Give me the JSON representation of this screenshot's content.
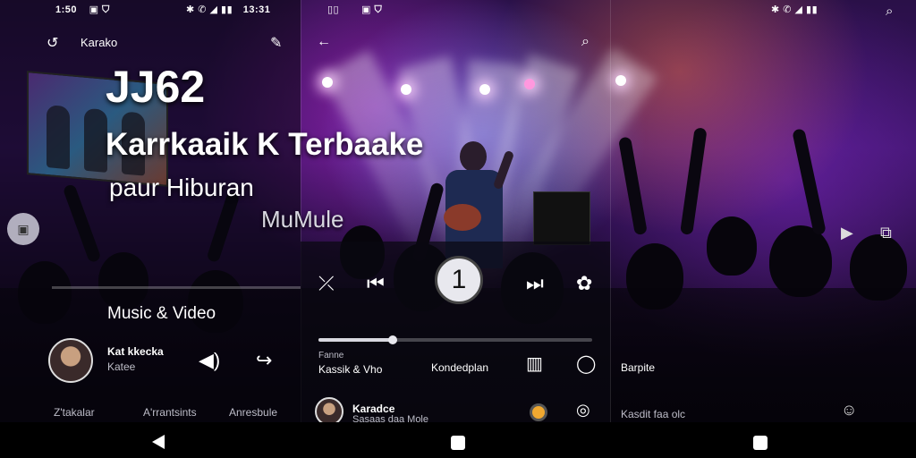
{
  "status_left": {
    "time": "1:50",
    "icons": "▣ ⛉"
  },
  "status_mid": {
    "left_icons": "▯▯",
    "center_icons": "▣ ⛉"
  },
  "status_right": {
    "icons": "✱ ✆ ◢ ▮▮",
    "time": "13:31"
  },
  "status_far_right": {
    "icons": "✱ ✆ ◢ ▮▮"
  },
  "left_panel": {
    "app_title": "Karako",
    "big_title": "JJ62",
    "title_line2": "Karrkaaik K Terbaake",
    "title_line3": "paur Hiburan",
    "mulele": "MuMule",
    "section_title": "Music & Video",
    "user_name": "Kat kkecka",
    "user_sub": "Katee",
    "tabs": [
      "Z'takalar",
      "A'rrantsints",
      "Anresbule"
    ]
  },
  "mid_panel": {
    "play_number": "1",
    "progress": 0.27,
    "meta_label": "Fanne",
    "meta_value": "Kassik  &  Vho",
    "center_label": "Kondedplan",
    "user_name": "Karadce",
    "user_sub": "Sasaas daa Mole"
  },
  "right_panel": {
    "label": "Barpite",
    "bottom_text": "Kasdit  faa  olc"
  },
  "icons": {
    "back": "back-arrow-icon",
    "search": "search-icon",
    "edit": "edit-icon",
    "shuffle": "shuffle-icon",
    "prev": "skip-previous-icon",
    "next": "skip-next-icon",
    "settings": "settings-icon"
  }
}
